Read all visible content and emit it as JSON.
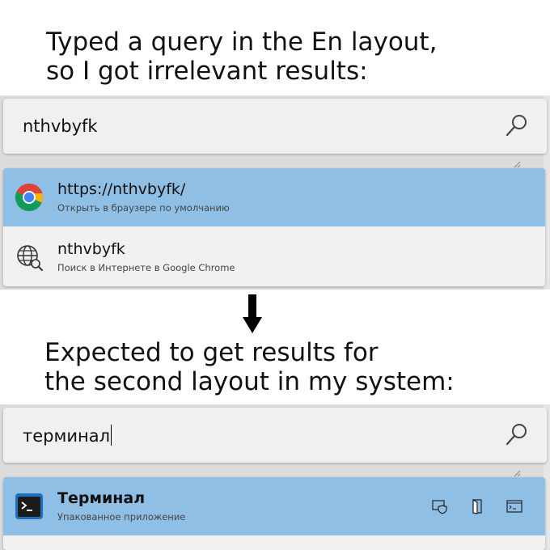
{
  "top_caption": {
    "line1": "Typed a query in the En layout,",
    "line2": "so I got irrelevant results:"
  },
  "bottom_caption": {
    "line1": "Expected to get results for",
    "line2": "the second layout in my system:"
  },
  "top_launcher": {
    "query": "nthvbyfk",
    "results": [
      {
        "title": "https://nthvbyfk/",
        "subtitle": "Открыть в браузере по умолчанию",
        "icon": "chrome-icon",
        "selected": true
      },
      {
        "title": "nthvbyfk",
        "subtitle": "Поиск в Интернете в Google Chrome",
        "icon": "web-search-globe-icon",
        "selected": false
      }
    ]
  },
  "bottom_launcher": {
    "query": "терминал",
    "results": [
      {
        "title": "Терминал",
        "subtitle": "Упакованное приложение",
        "icon": "terminal-icon",
        "selected": true,
        "actions": [
          "run-as-admin-icon",
          "open-folder-icon",
          "open-in-console-icon"
        ]
      }
    ]
  },
  "colors": {
    "selected_row": "#90bfe6",
    "panel_bg": "#f1f1f1",
    "terminal_blue": "#1f6fbf"
  }
}
